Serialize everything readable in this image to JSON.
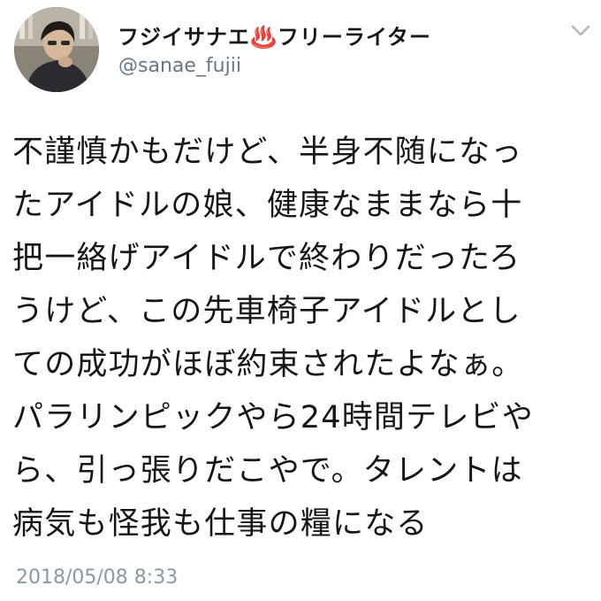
{
  "author": {
    "display_name": "フジイサナエ♨️フリーライター",
    "username": "@sanae_fujii",
    "avatar_icon": "profile-photo"
  },
  "menu_icon": "chevron-down-icon",
  "tweet": {
    "lines": [
      "不謹慎かもだけど、半身不随になっ",
      "たアイドルの娘、健康なままなら十",
      "把一絡げアイドルで終わりだったろ",
      "うけど、この先車椅子アイドルとし",
      "ての成功がほぼ約束されたよなぁ。",
      "パラリンピックやら24時間テレビや",
      "ら、引っ張りだこやで。タレントは",
      "病気も怪我も仕事の糧になる"
    ],
    "timestamp": "2018/05/08 8:33"
  },
  "colors": {
    "text": "#14171a",
    "secondary": "#657786",
    "timestamp": "#8899a6"
  }
}
